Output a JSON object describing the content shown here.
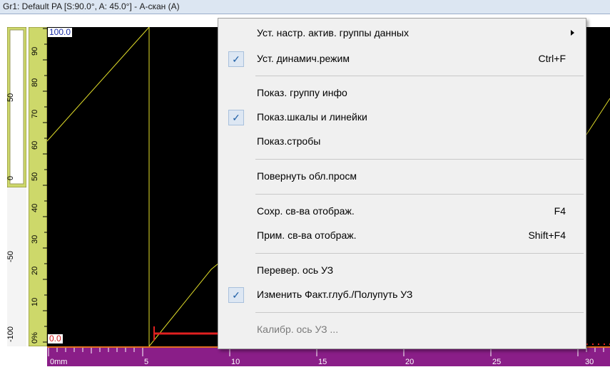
{
  "window": {
    "title": "Gr1: Default PA [S:90.0°, A: 45.0°] - А-скан (А)"
  },
  "view": {
    "amp_top_label": "100.0",
    "amp_bottom_label": "0.0",
    "left_scale_labels": [
      "50",
      "0",
      "-50",
      "-100"
    ],
    "percent_scale_labels": [
      "90",
      "80",
      "70",
      "60",
      "50",
      "40",
      "30",
      "20",
      "10",
      "0%"
    ],
    "bottom_scale_labels": [
      "0mm",
      "5",
      "10",
      "15",
      "20",
      "25",
      "30"
    ],
    "colors": {
      "signal": "#e4e02a",
      "background": "#000000",
      "gate": "#e02020",
      "scale_green": "#cdd86a",
      "scale_purple": "#8a1e88"
    }
  },
  "context_menu": {
    "items": [
      {
        "label": "Уст. настр. актив. группы данных",
        "checked": false,
        "shortcut": "",
        "submenu": true,
        "disabled": false
      },
      {
        "label": "Уст. динамич.режим",
        "checked": true,
        "shortcut": "Ctrl+F",
        "submenu": false,
        "disabled": false
      },
      {
        "label": "Показ. группу инфо",
        "checked": false,
        "shortcut": "",
        "submenu": false,
        "disabled": false
      },
      {
        "label": "Показ.шкалы и линейки",
        "checked": true,
        "shortcut": "",
        "submenu": false,
        "disabled": false
      },
      {
        "label": "Показ.стробы",
        "checked": false,
        "shortcut": "",
        "submenu": false,
        "disabled": false
      },
      {
        "label": "Повернуть обл.просм",
        "checked": false,
        "shortcut": "",
        "submenu": false,
        "disabled": false
      },
      {
        "label": "Сохр. св-ва отображ.",
        "checked": false,
        "shortcut": "F4",
        "submenu": false,
        "disabled": false
      },
      {
        "label": "Прим. св-ва отображ.",
        "checked": false,
        "shortcut": "Shift+F4",
        "submenu": false,
        "disabled": false
      },
      {
        "label": "Перевер. ось УЗ",
        "checked": false,
        "shortcut": "",
        "submenu": false,
        "disabled": false
      },
      {
        "label": "Изменить Факт.глуб./Полупуть УЗ",
        "checked": true,
        "shortcut": "",
        "submenu": false,
        "disabled": false
      },
      {
        "label": "Калибр. ось УЗ ...",
        "checked": false,
        "shortcut": "",
        "submenu": false,
        "disabled": true
      }
    ],
    "check_mark": "✓"
  }
}
